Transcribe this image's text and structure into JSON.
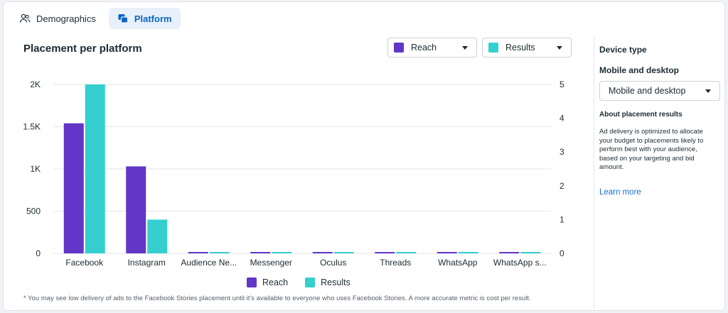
{
  "tabs": [
    {
      "label": "Demographics",
      "icon": "people-icon",
      "active": false
    },
    {
      "label": "Platform",
      "icon": "platform-icon",
      "active": true
    }
  ],
  "chart_title": "Placement per platform",
  "metric_selectors": [
    {
      "label": "Reach",
      "color": "#6236c6"
    },
    {
      "label": "Results",
      "color": "#35cfcf"
    }
  ],
  "chart_data": {
    "type": "bar",
    "title": "Placement per platform",
    "categories": [
      "Facebook",
      "Instagram",
      "Audience Ne...",
      "Messenger",
      "Oculus",
      "Threads",
      "WhatsApp",
      "WhatsApp s..."
    ],
    "series": [
      {
        "name": "Reach",
        "axis": "left",
        "color": "#6236c6",
        "values": [
          1540,
          1030,
          5,
          5,
          5,
          5,
          5,
          5
        ]
      },
      {
        "name": "Results",
        "axis": "right",
        "color": "#35cfcf",
        "values": [
          5,
          1,
          0,
          0,
          0,
          0,
          0,
          0
        ]
      }
    ],
    "y_left": {
      "ylim": [
        0,
        2000
      ],
      "ticks": [
        0,
        500,
        1000,
        1500,
        2000
      ],
      "tick_labels": [
        "0",
        "500",
        "1K",
        "1.5K",
        "2K"
      ]
    },
    "y_right": {
      "ylim": [
        0,
        5
      ],
      "ticks": [
        0,
        1,
        2,
        3,
        4,
        5
      ],
      "tick_labels": [
        "0",
        "1",
        "2",
        "3",
        "4",
        "5"
      ]
    },
    "grid": true,
    "legend": "bottom"
  },
  "legend": [
    {
      "label": "Reach",
      "color": "#6236c6"
    },
    {
      "label": "Results",
      "color": "#35cfcf"
    }
  ],
  "footnote": "* You may see low delivery of ads to the Facebook Stories placement until it's available to everyone who uses Facebook Stories. A more accurate metric is cost per result.",
  "sidebar": {
    "device_heading": "Device type",
    "device_subheading": "Mobile and desktop",
    "device_select_value": "Mobile and desktop",
    "about_heading": "About placement results",
    "about_text": "Ad delivery is optimized to allocate your budget to placements likely to perform best with your audience, based on your targeting and bid amount.",
    "learn_more": "Learn more"
  }
}
